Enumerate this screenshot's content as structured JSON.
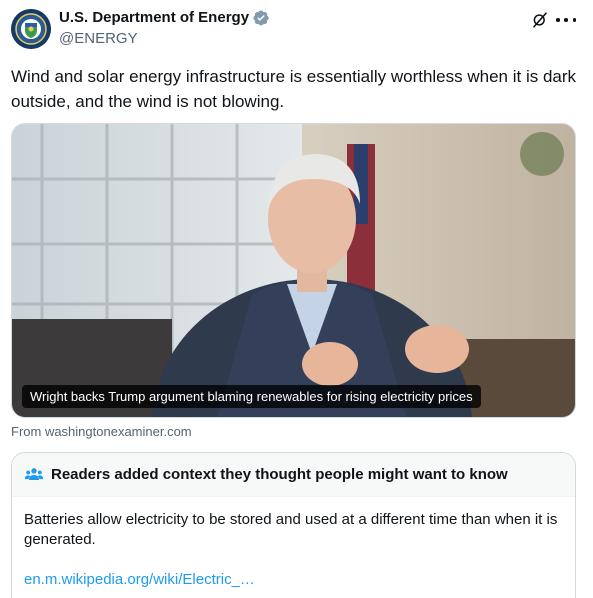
{
  "author": {
    "display_name": "U.S. Department of Energy",
    "handle": "@ENERGY",
    "verified_icon": "verified-badge-icon",
    "verified_color": "#829aab"
  },
  "actions": {
    "grok_icon": "grok-icon",
    "more_icon": "more-options-icon"
  },
  "tweet": {
    "text": "Wind and solar energy infrastructure is essentially worthless when it is dark outside, and the wind is not blowing."
  },
  "media": {
    "caption": "Wright backs Trump argument blaming renewables for rising electricity prices",
    "source": "From washingtonexaminer.com"
  },
  "community_note": {
    "title": "Readers added context they thought people might want to know",
    "icon": "people-icon",
    "body": "Batteries allow electricity to be stored and used at a different time than when it is generated.",
    "link": "en.m.wikipedia.org/wiki/Electric_…",
    "link_color": "#1d9bf0"
  }
}
